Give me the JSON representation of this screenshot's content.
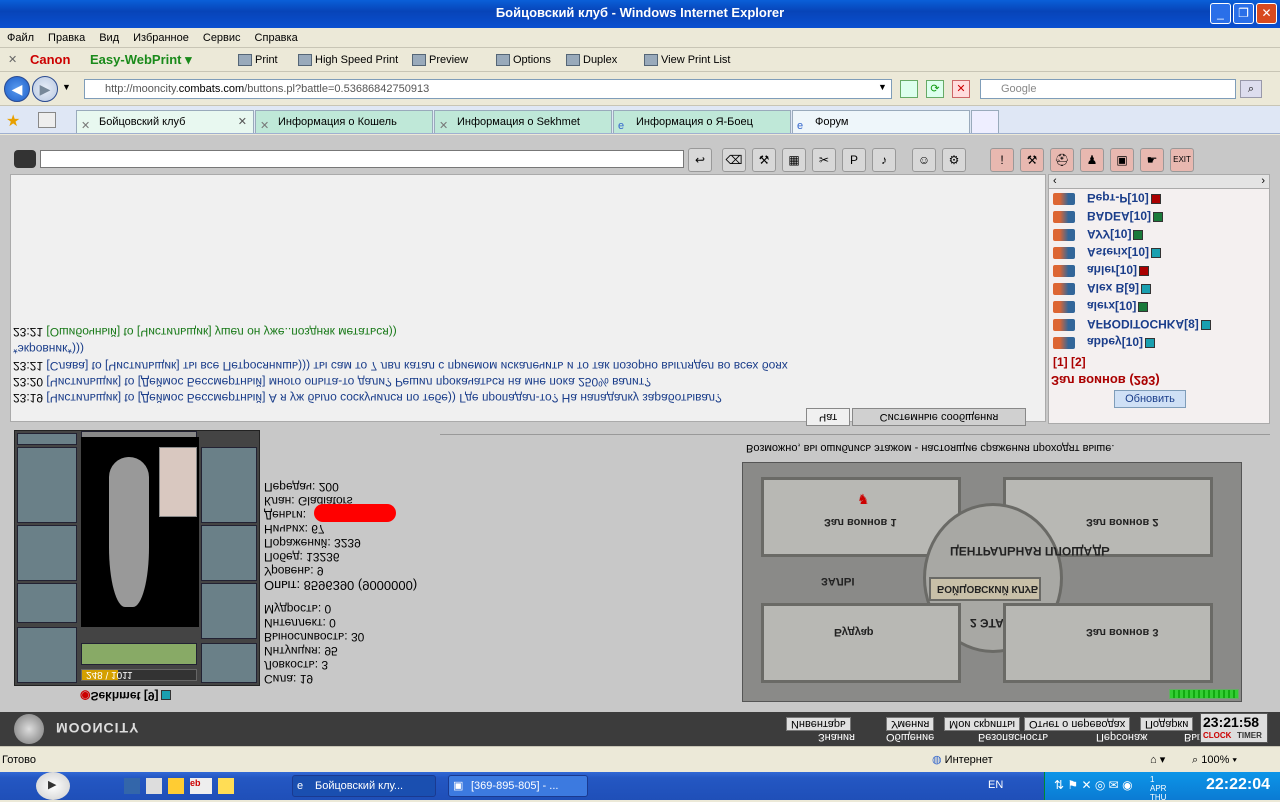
{
  "window": {
    "title": "Бойцовский клуб - Windows Internet Explorer"
  },
  "menu": [
    "Файл",
    "Правка",
    "Вид",
    "Избранное",
    "Сервис",
    "Справка"
  ],
  "printbar": {
    "brand": "Canon",
    "product": "Easy-WebPrint",
    "items": [
      "Print",
      "High Speed Print",
      "Preview",
      "Options",
      "Duplex",
      "View Print List"
    ]
  },
  "address": {
    "url_prefix": "http://mooncity.",
    "url_domain": "combats.com",
    "url_suffix": "/buttons.pl?battle=0.53686842750913",
    "search_placeholder": "Google"
  },
  "tabs": [
    "Бойцовский клуб",
    "Информация о Кошель",
    "Информация о Sekhmet",
    "Информация о Я-Боец",
    "Форум"
  ],
  "chat": {
    "lines": [
      {
        "time": "23:21",
        "text": "[Ошибочный] to [Чистильщик] ушел он уже..поздняк метаться))",
        "color": "#1a7a1a"
      },
      {
        "time": "",
        "text": "*экровник*)))",
        "color": "#1a3d8a"
      },
      {
        "time": "23:21",
        "text": "[Слава] to [Чистильщик] ты все Петросянишь))) ты сам то 7 лвл катал с приемом искалечить и то так позорно выглядел во всех боях",
        "color": "#1a3d8a"
      },
      {
        "time": "23:20",
        "text": "[Чистильщик] to [Деймос Бессмертный] много опыта-то дали? Решил прокачаться на мне пока 250% валит?",
        "color": "#1a3d8a"
      },
      {
        "time": "23:19",
        "text": "[Чистильщик] to [Деймос Бессмертный] А я уж было соскучился по тебе)) Где пропадал-то? На нападалку заработывал?",
        "color": "#1a3d8a"
      }
    ],
    "tab_chat": "Чат",
    "tab_system": "Системные сообщения"
  },
  "users": {
    "list": [
      {
        "name": "Берт-Р",
        "level": "[10]",
        "badge": "#a00"
      },
      {
        "name": "BADEA",
        "level": "[10]",
        "badge": "#1a7a3a"
      },
      {
        "name": "АУУ",
        "level": "[10]",
        "badge": "#1a7a3a"
      },
      {
        "name": "Аsterix",
        "level": "[10]",
        "badge": "#1aa0b0"
      },
      {
        "name": "ahler",
        "level": "[10]",
        "badge": "#a00"
      },
      {
        "name": "Alex B",
        "level": "[9]",
        "badge": "#1aa0b0"
      },
      {
        "name": "alerx",
        "level": "[10]",
        "badge": "#1a7a3a"
      },
      {
        "name": "AFRODITOCHKA",
        "level": "[8]",
        "badge": "#1aa0b0"
      },
      {
        "name": "abbey",
        "level": "[10]",
        "badge": "#1aa0b0"
      }
    ],
    "pages": "[1] [2]",
    "total": "Зал воинов (293)",
    "refresh": "Обновить"
  },
  "character": {
    "name": "Sekhmet [9]",
    "hp": "248 \\ 1011",
    "stats": [
      "Передач: 200",
      "Клан: Gladiators",
      "Деньги:",
      "Ничьих: 67",
      "Поражений: 3239",
      "Побед: 13236",
      "Уровень: 9",
      "Опыт: 8596390 (9000000)",
      "",
      "Мудрость: 0",
      "Интеллект: 0",
      "Выносливость: 30",
      "Интуиция: 95",
      "Ловкость: 3",
      "Сила: 19"
    ]
  },
  "map": {
    "hint": "Возможно, вы ошиблись этажом - настоящие сражения проходят выше.",
    "labels": [
      "Зал воинов 1",
      "Зал воинов 2",
      "ЦЕНТРАЛЬНАЯ ПЛОЩАДЬ",
      "ЗАЛЫ",
      "БОЙЦОВСКИЙ КЛУБ",
      "2 ЭТАЖ",
      "Будуар",
      "Зал воинов 3"
    ]
  },
  "bottom": {
    "logo": "MOONCITY",
    "top_items": [
      "Инвентарь",
      "Умения",
      "Мои скрипты",
      "Отчет о переводах",
      "Подарки"
    ],
    "items": [
      "Знания",
      "Общение",
      "Безопасность",
      "Персонаж",
      "Вых"
    ],
    "timer": "23:21:58",
    "clock_label": "CLOCK",
    "timer_label": "TIMER"
  },
  "status": {
    "left": "Готово",
    "zone": "Интернет",
    "zoom": "100%"
  },
  "taskbar": {
    "tasks": [
      "Бойцовский клу...",
      "[369-895-805] - ..."
    ],
    "lang": "EN",
    "time": "22:22:04",
    "date": "1 APR THU"
  }
}
